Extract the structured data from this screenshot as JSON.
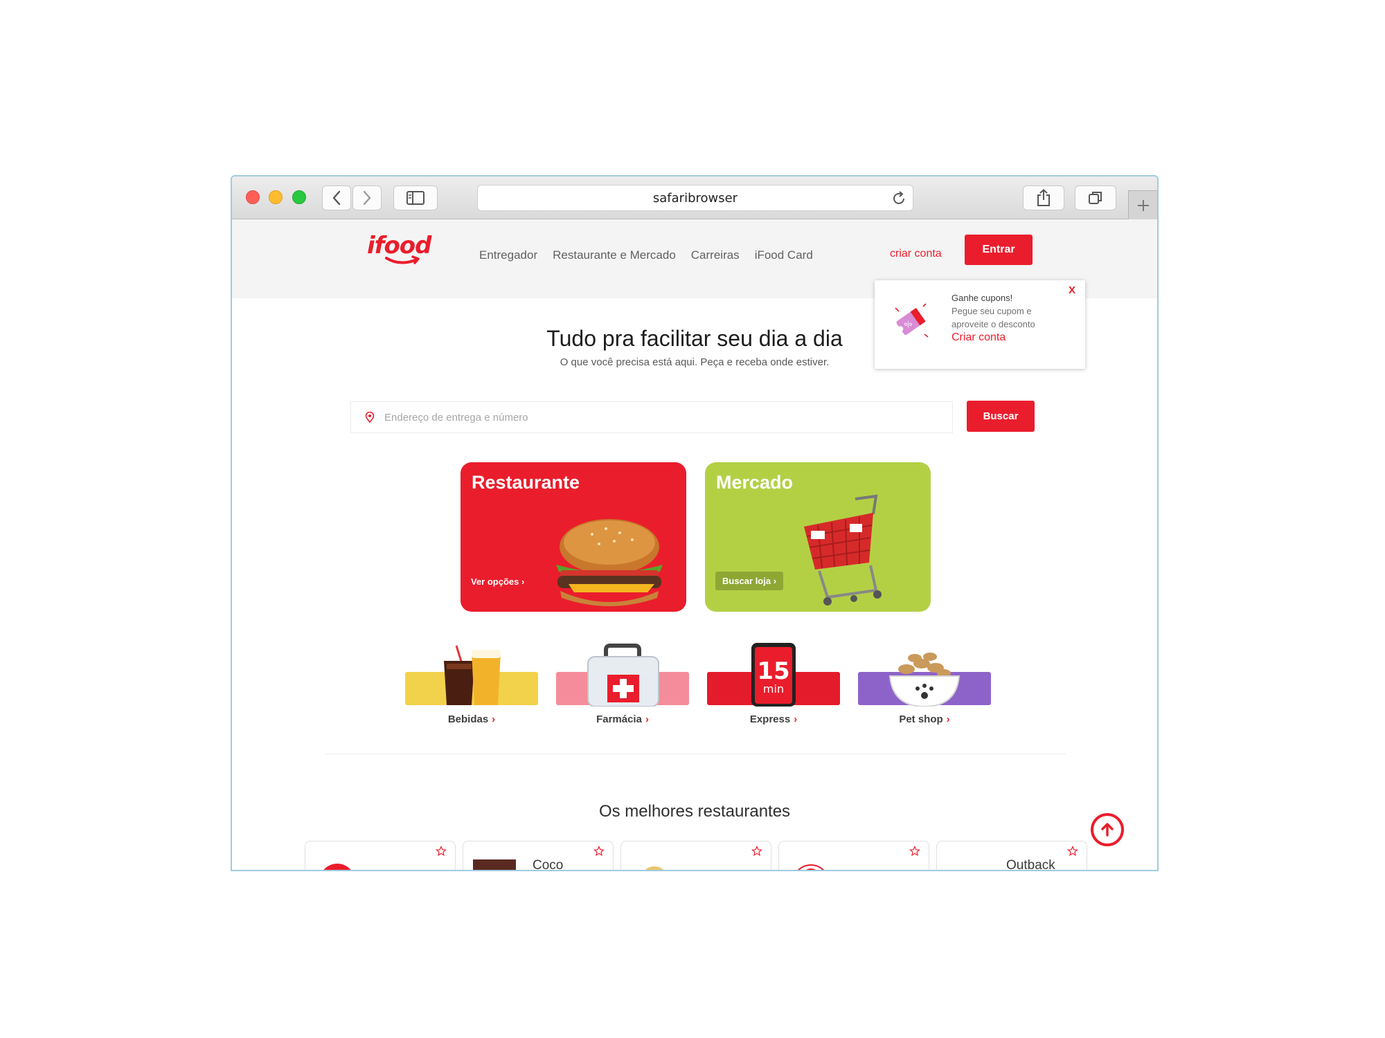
{
  "browser": {
    "url_text": "safaribrowser"
  },
  "header": {
    "logo_text": "ifood",
    "nav": [
      "Entregador",
      "Restaurante e Mercado",
      "Carreiras",
      "iFood Card"
    ],
    "criar_conta": "criar conta",
    "entrar": "Entrar"
  },
  "popup": {
    "close": "X",
    "title": "Ganhe cupons!",
    "body": "Pegue seu cupom e aproveite o desconto",
    "link": "Criar conta"
  },
  "hero": {
    "title": "Tudo pra facilitar seu dia a dia",
    "subtitle": "O que você precisa está aqui. Peça e receba onde estiver."
  },
  "search": {
    "placeholder": "Endereço de entrega e número",
    "button": "Buscar"
  },
  "cards": {
    "restaurante": {
      "title": "Restaurante",
      "button": "Ver opções ›"
    },
    "mercado": {
      "title": "Mercado",
      "button": "Buscar loja ›"
    }
  },
  "categories": [
    {
      "label": "Bebidas",
      "chevron": "›"
    },
    {
      "label": "Farmácia",
      "chevron": "›"
    },
    {
      "label": "Express",
      "chevron": "›",
      "badge_number": "15",
      "badge_unit": "min"
    },
    {
      "label": "Pet shop",
      "chevron": "›"
    }
  ],
  "section": {
    "title": "Os melhores restaurantes"
  },
  "restaurants": [
    {
      "name": ""
    },
    {
      "name": "Coco"
    },
    {
      "name": ""
    },
    {
      "name": ""
    },
    {
      "name": "Outback"
    }
  ],
  "colors": {
    "brand_red": "#ea1d2c",
    "mercado_green": "#b3d045",
    "bebidas_yellow": "#f2d24a",
    "farmacia_pink": "#f48c9b",
    "express_red": "#e41b2b",
    "petshop_purple": "#8e63c9"
  }
}
